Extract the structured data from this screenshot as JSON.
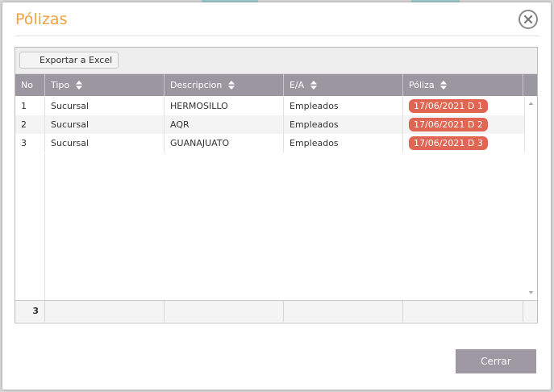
{
  "modal": {
    "title": "Pólizas",
    "close_icon": "close-icon"
  },
  "toolbar": {
    "export_label": "Exportar a Excel"
  },
  "columns": [
    {
      "label": "No",
      "sortable": false
    },
    {
      "label": "Tipo",
      "sortable": true
    },
    {
      "label": "Descripcion",
      "sortable": true
    },
    {
      "label": "E/A",
      "sortable": true
    },
    {
      "label": "Póliza",
      "sortable": true
    }
  ],
  "rows": [
    {
      "no": "1",
      "tipo": "Sucursal",
      "descripcion": "HERMOSILLO",
      "ea": "Empleados",
      "poliza": "17/06/2021 D 1"
    },
    {
      "no": "2",
      "tipo": "Sucursal",
      "descripcion": "AQR",
      "ea": "Empleados",
      "poliza": "17/06/2021 D 2"
    },
    {
      "no": "3",
      "tipo": "Sucursal",
      "descripcion": "GUANAJUATO",
      "ea": "Empleados",
      "poliza": "17/06/2021 D 3"
    }
  ],
  "footer": {
    "count": "3"
  },
  "actions": {
    "close_label": "Cerrar"
  },
  "colors": {
    "accent_title": "#f1a23c",
    "badge": "#e06552",
    "header": "#9a97a1",
    "button": "#9e98a2"
  }
}
